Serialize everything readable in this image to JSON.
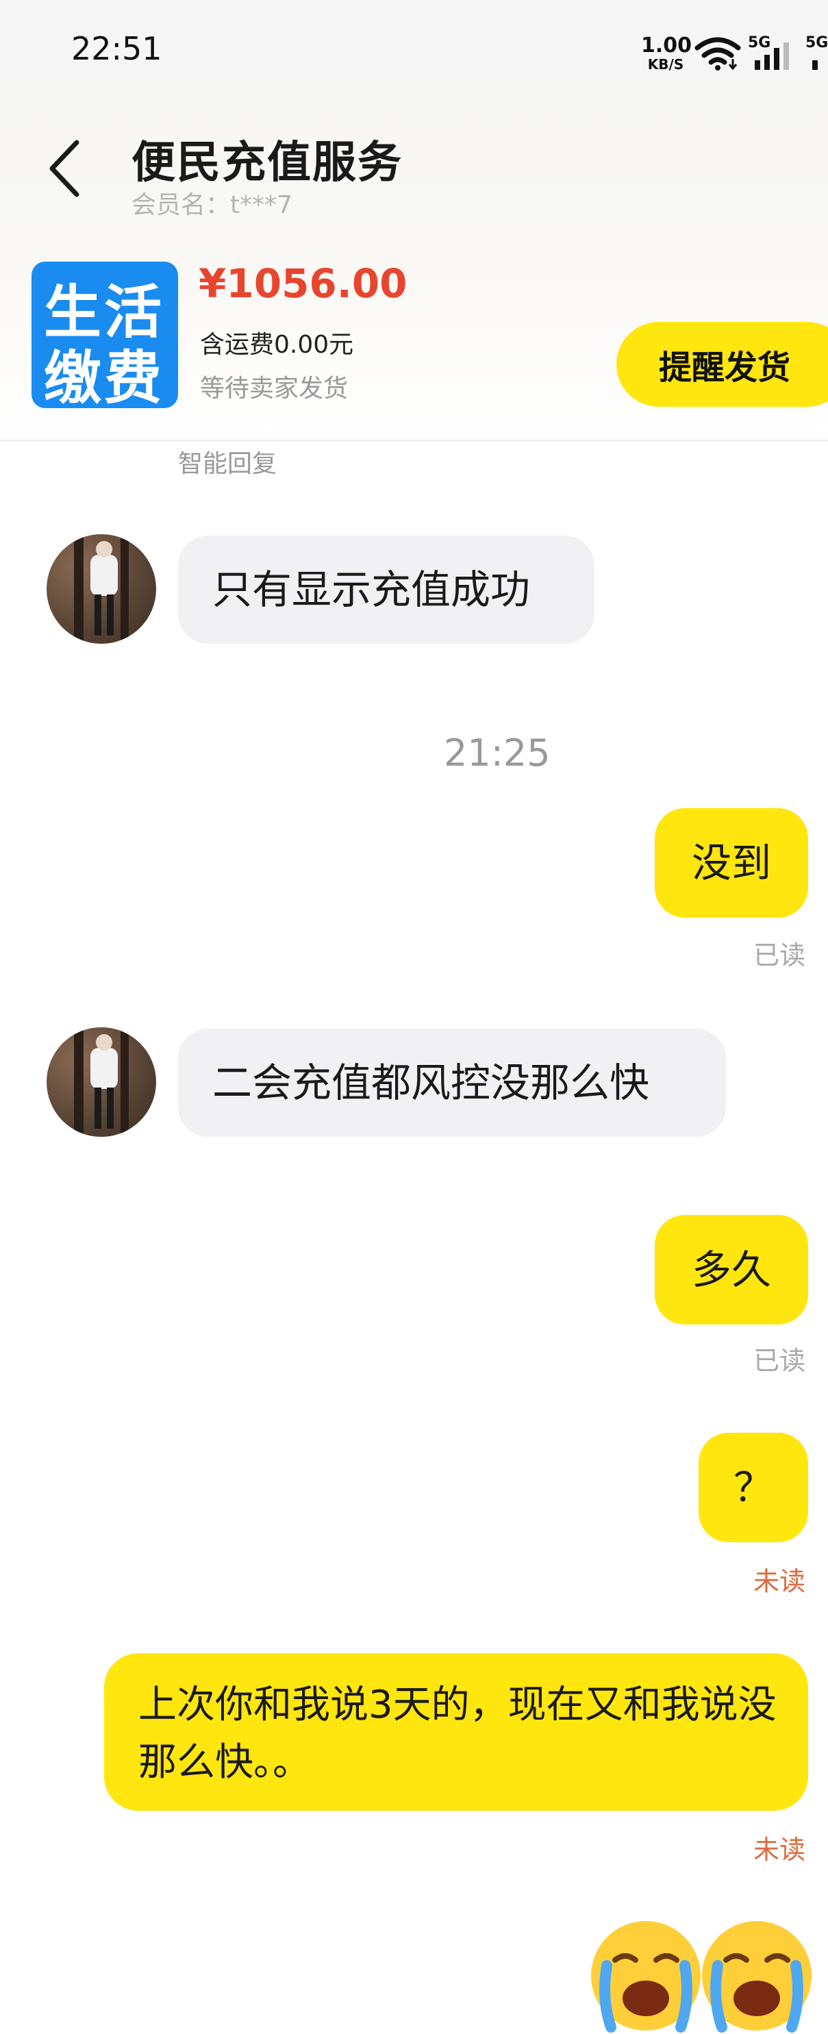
{
  "status_bar": {
    "time": "22:51",
    "net_speed_value": "1.00",
    "net_speed_unit": "KB/S",
    "signal_1_label": "5G",
    "signal_2_label": "5G"
  },
  "header": {
    "title": "便民充值服务",
    "member_name": "会员名：t***7"
  },
  "order": {
    "thumb_line1": "生活",
    "thumb_line2": "缴费",
    "price": "¥1056.00",
    "shipping": "含运费0.00元",
    "status": "等待卖家发货",
    "remind_button": "提醒发货"
  },
  "chat": {
    "smart_reply_label": "智能回复",
    "timestamp": "21:25",
    "messages": [
      {
        "side": "in",
        "text": "只有显示充值成功"
      },
      {
        "side": "out",
        "text": "没到",
        "receipt": "已读"
      },
      {
        "side": "in",
        "text": "二会充值都风控没那么快"
      },
      {
        "side": "out",
        "text": "多久",
        "receipt": "已读"
      },
      {
        "side": "out",
        "text": "？",
        "receipt": "未读"
      },
      {
        "side": "out",
        "text": "上次你和我说3天的，现在又和我说没那么快。。",
        "receipt": "未读"
      }
    ]
  },
  "colors": {
    "accent_yellow": "#ffe60f",
    "price_red": "#e8452f",
    "unread_orange": "#e06a3c",
    "thumb_blue": "#1a8cf0"
  },
  "icons": [
    "back-arrow-icon",
    "wifi-icon",
    "signal-icon",
    "crying-emoji-icon"
  ]
}
